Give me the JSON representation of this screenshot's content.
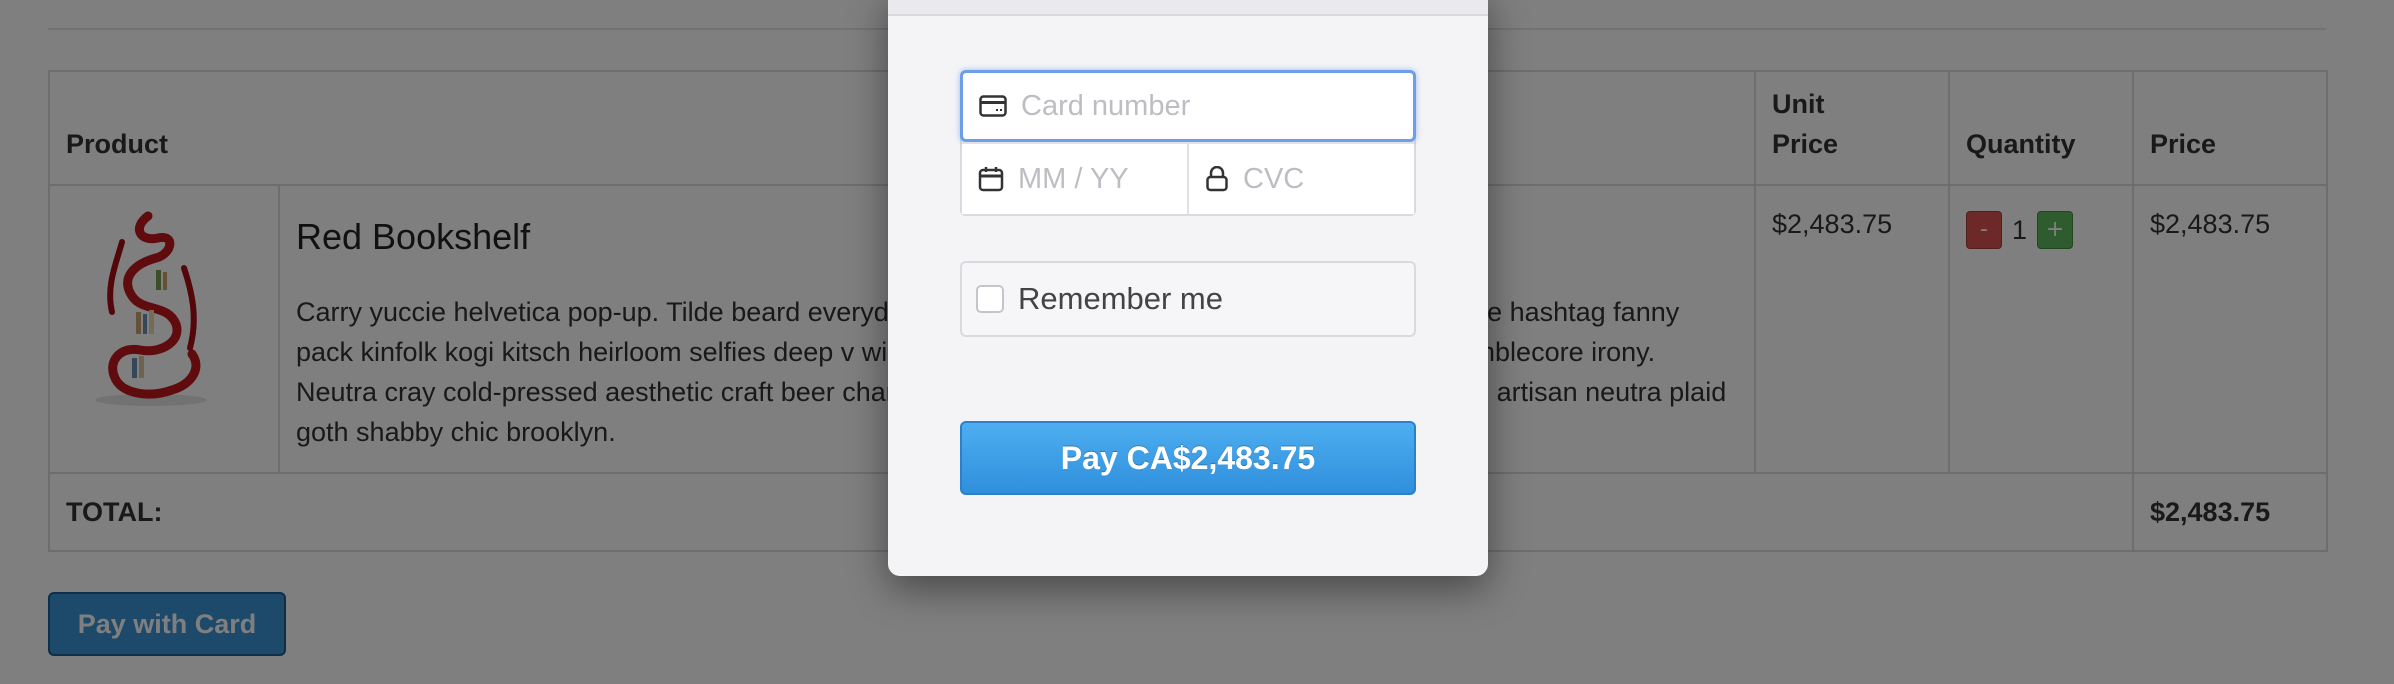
{
  "cart": {
    "headers": {
      "product": "Product",
      "unit_price_line1": "Unit",
      "unit_price_line2": "Price",
      "quantity": "Quantity",
      "price": "Price"
    },
    "item": {
      "name": "Red Bookshelf",
      "description": "Carry yuccie helvetica pop-up. Tilde beard everyday carry try-hard cliche freegan, single-origin coffee hashtag fanny pack kinfolk kogi kitsch heirloom selfies deep v williamsburg. Fixie diy actually leggings poutine mumblecore irony. Neutra cray cold-pressed aesthetic craft beer chambray flexitarian chia squid. Next level readymade artisan neutra plaid goth shabby chic brooklyn.",
      "unit_price": "$2,483.75",
      "qty_minus": "-",
      "quantity": "1",
      "qty_plus": "+",
      "price": "$2,483.75"
    },
    "total_label": "TOTAL:",
    "total_value": "$2,483.75",
    "pay_with_card": "Pay with Card"
  },
  "checkout": {
    "card_number_placeholder": "Card number",
    "expiry_placeholder": "MM / YY",
    "cvc_placeholder": "CVC",
    "remember_me": "Remember me",
    "pay_button": "Pay CA$2,483.75"
  },
  "colors": {
    "pay_button": "#3a9be3",
    "focus_ring": "#6d9ee8",
    "qty_minus": "#d9534f",
    "qty_plus": "#5cb85c",
    "product_red": "#c0171b"
  },
  "icons": {
    "card_number": "credit-card-icon",
    "expiry": "calendar-icon",
    "cvc": "lock-icon"
  }
}
